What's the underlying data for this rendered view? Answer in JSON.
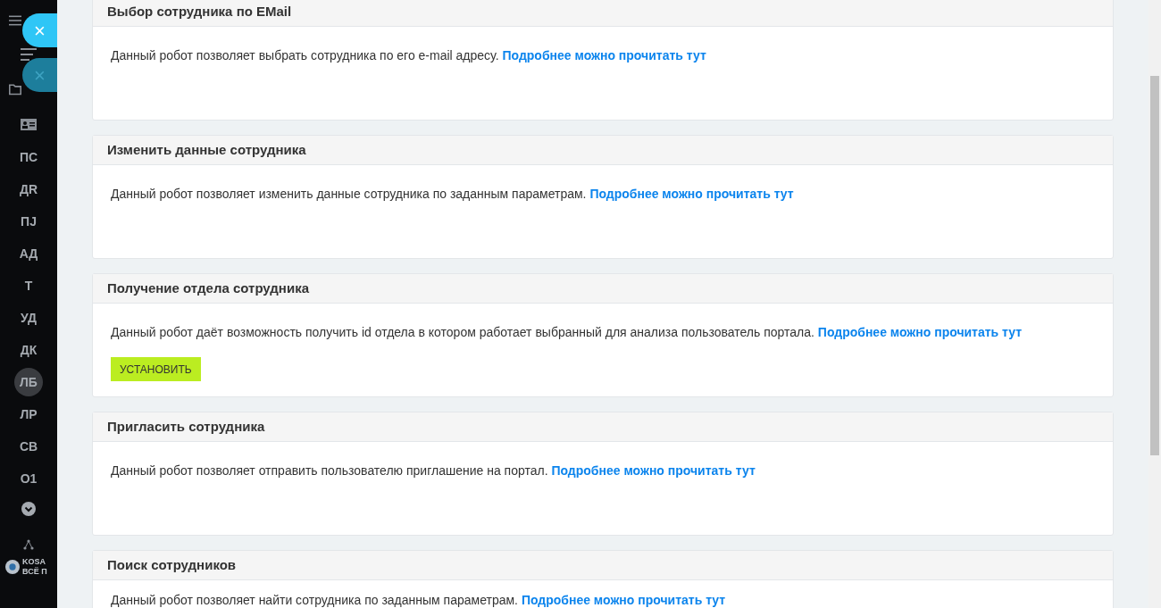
{
  "close_buttons": [
    {
      "label": "×",
      "dimmed": false
    },
    {
      "label": "×",
      "dimmed": true
    }
  ],
  "sidebar": {
    "items": [
      {
        "label": "ПС",
        "selected": false
      },
      {
        "label": "ДR",
        "selected": false
      },
      {
        "label": "ПJ",
        "selected": false
      },
      {
        "label": "АД",
        "selected": false
      },
      {
        "label": "Т",
        "selected": false
      },
      {
        "label": "УД",
        "selected": false
      },
      {
        "label": "ДК",
        "selected": false
      },
      {
        "label": "ЛБ",
        "selected": true
      },
      {
        "label": "ЛР",
        "selected": false
      },
      {
        "label": "СВ",
        "selected": false
      },
      {
        "label": "О1",
        "selected": false
      }
    ],
    "logo": {
      "line_1": "KOSA",
      "line_2": "ВСЁ П"
    }
  },
  "cards": [
    {
      "title": "Выбор сотрудника по EMail",
      "text": "Данный робот позволяет выбрать сотрудника по его e-mail адресу.",
      "link": "Подробнее можно прочитать тут"
    },
    {
      "title": "Изменить данные сотрудника",
      "text": "Данный робот позволяет изменить данные сотрудника по заданным параметрам.",
      "link": "Подробнее можно прочитать тут"
    },
    {
      "title": "Получение отдела сотрудника",
      "text": "Данный робот даёт возможность получить id отдела в котором работает выбранный для анализа пользователь портала.",
      "link": "Подробнее можно прочитать тут",
      "button": "УСТАНОВИТЬ"
    },
    {
      "title": "Пригласить сотрудника",
      "text": "Данный робот позволяет отправить пользователю приглашение на портал.",
      "link": "Подробнее можно прочитать тут"
    },
    {
      "title": "Поиск сотрудников",
      "text": "Данный робот позволяет найти сотрудника по заданным параметрам.",
      "link": "Подробнее можно прочитать тут"
    }
  ]
}
